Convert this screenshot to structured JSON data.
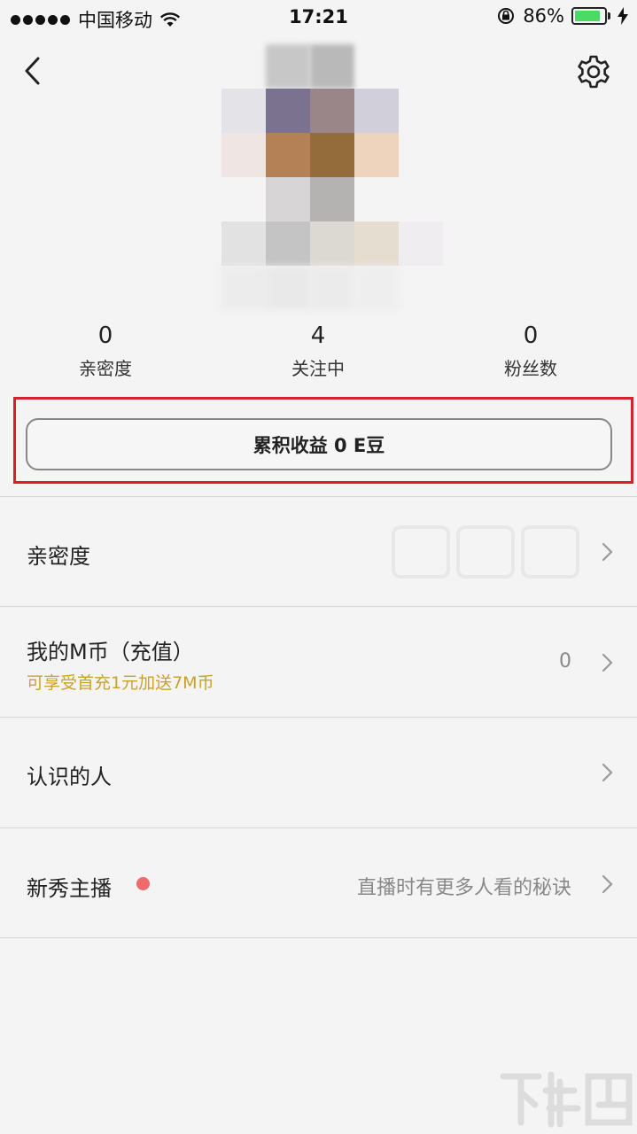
{
  "status_bar": {
    "carrier": "中国移动",
    "time": "17:21",
    "battery_percent": "86%",
    "battery_level": 0.86
  },
  "header": {
    "back_icon": "chevron-left-icon",
    "settings_icon": "gear-icon"
  },
  "stats": [
    {
      "value": "0",
      "label": "亲密度"
    },
    {
      "value": "4",
      "label": "关注中"
    },
    {
      "value": "0",
      "label": "粉丝数"
    }
  ],
  "earnings_button": {
    "label": "累积收益 0 E豆"
  },
  "menu": [
    {
      "title": "亲密度"
    },
    {
      "title": "我的M币（充值）",
      "subtitle": "可享受首充1元加送7M币",
      "value": "0"
    },
    {
      "title": "认识的人"
    },
    {
      "title": "新秀主播",
      "value": "直播时有更多人看的秘诀"
    }
  ],
  "colors": {
    "accent_gold": "#c9a227",
    "highlight_red": "#d8202a",
    "battery_green": "#4cd964",
    "notify_dot": "#ef6a6a"
  }
}
